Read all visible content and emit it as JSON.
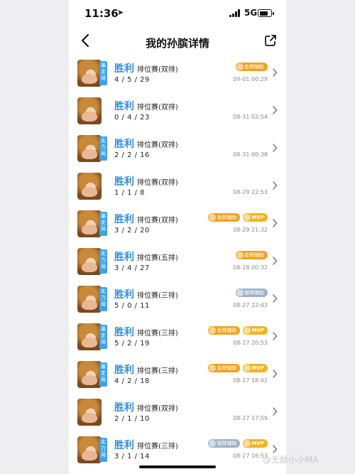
{
  "status": {
    "time": "11:36",
    "network": "5G"
  },
  "header": {
    "title": "我的孙膑详情"
  },
  "watermark": "@无敌小小MA",
  "rows": [
    {
      "tag": "暴走局",
      "result": "胜利",
      "mode": "排位赛(双排)",
      "kda": "4 / 5 / 29",
      "time": "09-01 00:29",
      "badges": [
        {
          "type": "gold",
          "label": "金牌辅助"
        }
      ]
    },
    {
      "tag": "",
      "result": "胜利",
      "mode": "排位赛(双排)",
      "kda": "0 / 4 / 23",
      "time": "08-31 02:54",
      "badges": []
    },
    {
      "tag": "实力局",
      "result": "胜利",
      "mode": "排位赛(双排)",
      "kda": "2 / 2 / 16",
      "time": "08-31 00:38",
      "badges": []
    },
    {
      "tag": "",
      "result": "胜利",
      "mode": "排位赛(双排)",
      "kda": "1 / 1 / 8",
      "time": "08-29 22:53",
      "badges": []
    },
    {
      "tag": "暴走局",
      "result": "胜利",
      "mode": "排位赛(双排)",
      "kda": "3 / 2 / 20",
      "time": "08-29 21:32",
      "badges": [
        {
          "type": "gold",
          "label": "金牌辅助"
        },
        {
          "type": "mvp",
          "label": "MVP"
        }
      ]
    },
    {
      "tag": "实力局",
      "result": "胜利",
      "mode": "排位赛(五排)",
      "kda": "3 / 4 / 27",
      "time": "08-28 00:32",
      "badges": [
        {
          "type": "gold",
          "label": "金牌辅助"
        }
      ]
    },
    {
      "tag": "实力局",
      "result": "胜利",
      "mode": "排位赛(三排)",
      "kda": "5 / 0 / 11",
      "time": "08-27 22:43",
      "badges": [
        {
          "type": "silver",
          "label": "银牌辅助"
        }
      ]
    },
    {
      "tag": "暴走局",
      "result": "胜利",
      "mode": "排位赛(三排)",
      "kda": "5 / 2 / 19",
      "time": "08-27 20:53",
      "badges": [
        {
          "type": "gold",
          "label": "金牌辅助"
        },
        {
          "type": "mvp",
          "label": "MVP"
        }
      ]
    },
    {
      "tag": "暴走局",
      "result": "胜利",
      "mode": "排位赛(三排)",
      "kda": "4 / 2 / 18",
      "time": "08-27 18:42",
      "badges": [
        {
          "type": "gold",
          "label": "金牌辅助"
        },
        {
          "type": "mvp",
          "label": "MVP"
        }
      ]
    },
    {
      "tag": "",
      "result": "胜利",
      "mode": "排位赛(双排)",
      "kda": "2 / 1 / 10",
      "time": "08-27 17:59",
      "badges": []
    },
    {
      "tag": "实力局",
      "result": "胜利",
      "mode": "排位赛(三排)",
      "kda": "3 / 1 / 14",
      "time": "08-27 16:53",
      "badges": [
        {
          "type": "silver",
          "label": "银牌辅助"
        },
        {
          "type": "mvp",
          "label": "MVP"
        }
      ]
    }
  ]
}
